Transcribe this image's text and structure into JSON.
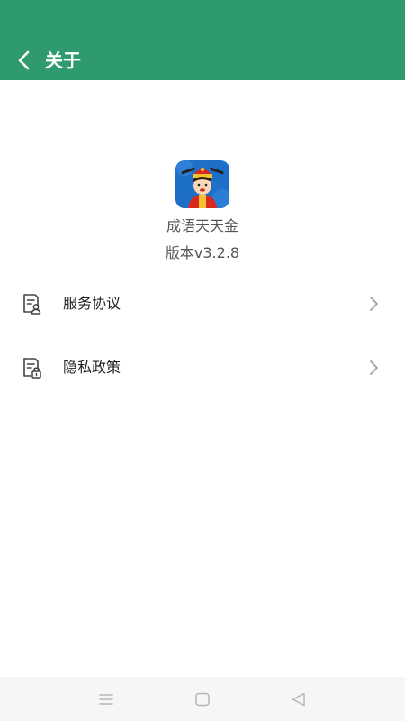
{
  "header": {
    "title": "关于",
    "background_color": "#2e9a6e",
    "back_icon": "chevron-left-icon"
  },
  "app": {
    "icon": "app-logo-icon",
    "name": "成语天天金",
    "version": "版本v3.2.8"
  },
  "menu": [
    {
      "label": "服务协议",
      "icon": "document-user-icon"
    },
    {
      "label": "隐私政策",
      "icon": "document-lock-icon"
    }
  ],
  "system_nav": {
    "buttons": [
      "menu-icon",
      "home-icon",
      "back-triangle-icon"
    ]
  }
}
